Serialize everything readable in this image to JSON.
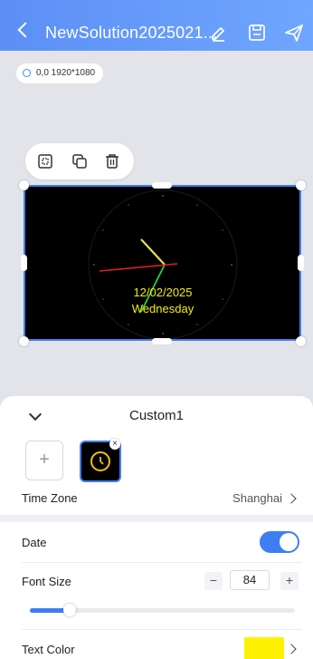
{
  "header": {
    "title": "NewSolution2025021...",
    "back_icon": "chevron-left-icon",
    "edit_icon": "pencil-icon",
    "save_icon": "save-icon",
    "publish_icon": "send-icon"
  },
  "canvas": {
    "resolution_label": "0,0 1920*1080"
  },
  "toolbar": {
    "icons": [
      "fullscreen-icon",
      "copy-icon",
      "delete-icon"
    ]
  },
  "clock_preview": {
    "date_text": "12/02/2025",
    "weekday_text": "Wednesday",
    "text_color": "#f5f000",
    "hour_hand_color": "#e8e050",
    "minute_hand_color": "#2ecc40",
    "second_hand_color": "#e02020"
  },
  "panel": {
    "title": "Custom1",
    "add_label": "+",
    "close_label": "×",
    "time_zone_label": "Time Zone",
    "time_zone_value": "Shanghai",
    "date_label": "Date",
    "date_enabled": true,
    "font_size_label": "Font Size",
    "font_size_value": "84",
    "minus_label": "−",
    "plus_label": "+",
    "font_size_slider_fraction": 0.15,
    "text_color_label": "Text Color",
    "text_color_value": "#fff200",
    "accent_color": "#3f7ef2"
  }
}
